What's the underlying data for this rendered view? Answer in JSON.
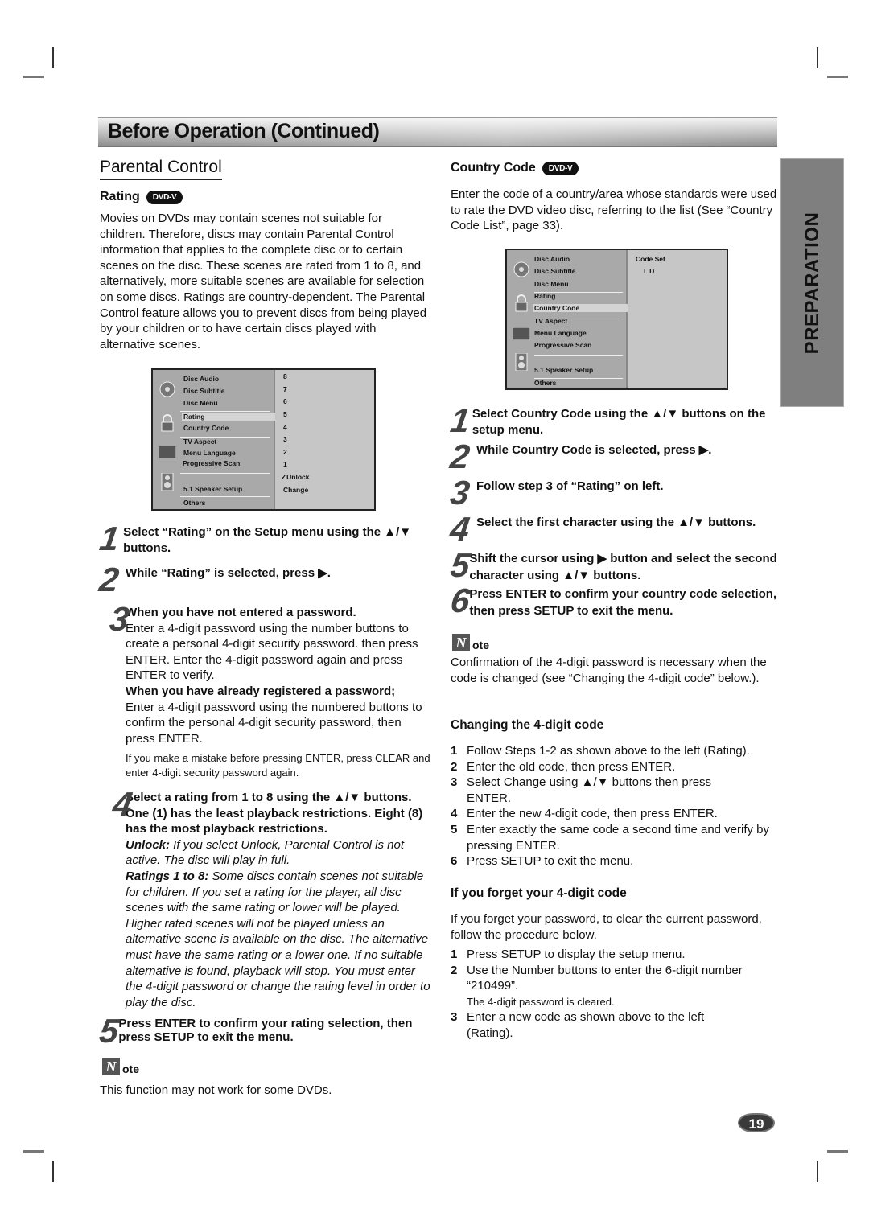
{
  "header": {
    "title": "Before Operation (Continued)"
  },
  "side_tab": {
    "label": "PREPARATION"
  },
  "page_number": "19",
  "parental": {
    "title": "Parental Control",
    "rating": {
      "heading": "Rating",
      "badge": "DVD-V",
      "intro": "Movies on DVDs may contain scenes not suitable for children. Therefore, discs may contain Parental Control information that applies to the complete disc or to certain scenes on the disc. These scenes are rated from 1 to 8, and alternatively, more suitable scenes are available for selection on some discs. Ratings are country-dependent. The Parental Control feature allows you to prevent discs from being played by your children or to have certain discs played with alternative scenes.",
      "menu": {
        "items": [
          "Disc Audio",
          "Disc Subtitle",
          "Disc Menu",
          "Rating",
          "Country Code",
          "TV Aspect",
          "Menu Language",
          "Progressive Scan",
          "5.1 Speaker Setup",
          "Others"
        ],
        "selected": "Rating",
        "values": [
          "8",
          "7",
          "6",
          "5",
          "4",
          "3",
          "2",
          "1",
          "✓Unlock",
          "Change"
        ]
      },
      "steps": [
        {
          "num": "1",
          "text": "Select “Rating” on the Setup menu using the ▲/▼ buttons."
        },
        {
          "num": "2",
          "text": "While “Rating” is selected, press ▶."
        },
        {
          "num": "3",
          "head1": "When you have not entered a password.",
          "body1": "Enter a 4-digit password using the number buttons to create a personal 4-digit security password. then press ENTER. Enter the 4-digit password again and press ENTER to verify.",
          "head2": "When you have already registered a password;",
          "body2": "Enter a 4-digit password using the numbered buttons to confirm the personal 4-digit security password, then press ENTER.",
          "tip": "If you make a mistake before pressing ENTER, press CLEAR and enter 4-digit security password again."
        },
        {
          "num": "4",
          "text": "Select a rating from 1 to 8 using the ▲/▼ buttons. One (1) has the least playback restrictions. Eight (8) has the most playback restrictions.",
          "unlock_label": "Unlock:",
          "unlock_text": " If you select Unlock, Parental Control is not active. The disc will play in full.",
          "ratings_label": "Ratings 1 to 8:",
          "ratings_text": " Some discs contain scenes not suitable for children. If you set a rating for the player, all disc scenes with the same rating or lower will be played. Higher rated scenes will not be played unless an alternative scene is available on the disc. The alternative must have the same rating or a lower one. If no suitable alternative is found, playback will stop. You must enter the 4-digit password or change the rating level in order to play the disc."
        },
        {
          "num": "5",
          "text": "Press ENTER to confirm your rating selection, then press SETUP to exit the menu."
        }
      ],
      "note": {
        "icon": "N",
        "label": "ote",
        "text": "This function may not work for some DVDs."
      }
    }
  },
  "country_code": {
    "heading": "Country Code",
    "badge": "DVD-V",
    "intro": "Enter the code of a country/area whose standards were used to rate the DVD video disc, referring to the list (See “Country Code List”, page 33).",
    "menu": {
      "items": [
        "Disc Audio",
        "Disc Subtitle",
        "Disc Menu",
        "Rating",
        "Country Code",
        "TV Aspect",
        "Menu Language",
        "Progressive Scan",
        "5.1 Speaker Setup",
        "Others"
      ],
      "selected": "Country Code",
      "code_set_label": "Code Set",
      "code_value": "I  D"
    },
    "steps": [
      {
        "num": "1",
        "text": "Select Country Code using the ▲/▼ buttons on the setup menu."
      },
      {
        "num": "2",
        "text": "While Country Code is selected, press ▶."
      },
      {
        "num": "3",
        "text": "Follow step 3 of “Rating” on left."
      },
      {
        "num": "4",
        "text": "Select the first character using the ▲/▼ buttons."
      },
      {
        "num": "5",
        "text": "Shift the cursor using ▶ button and select the second character using ▲/▼ buttons."
      },
      {
        "num": "6",
        "text": "Press ENTER to confirm your country code selection, then press SETUP to exit the menu."
      }
    ],
    "note": {
      "icon": "N",
      "label": "ote",
      "text": "Confirmation of the 4-digit password is necessary when the code is changed (see “Changing the 4-digit code” below.)."
    }
  },
  "changing": {
    "heading": "Changing the 4-digit code",
    "items": [
      {
        "n": "1",
        "text": "Follow Steps 1-2 as shown above to the left (Rating)."
      },
      {
        "n": "2",
        "text": "Enter the old code, then press ENTER."
      },
      {
        "n": "3",
        "text": "Select Change using ▲/▼ buttons then press ENTER."
      },
      {
        "n": "4",
        "text": "Enter the new 4-digit code, then press ENTER."
      },
      {
        "n": "5",
        "text": "Enter exactly the same code a second time and verify by pressing ENTER."
      },
      {
        "n": "6",
        "text": "Press SETUP to exit the menu."
      }
    ]
  },
  "forget": {
    "heading": "If you forget your 4-digit code",
    "intro": "If you forget your password, to clear the current password, follow the procedure below.",
    "items": [
      {
        "n": "1",
        "text": "Press SETUP to display the setup menu."
      },
      {
        "n": "2",
        "text": "Use the Number buttons to enter the 6-digit number “210499”.",
        "sub": "The 4-digit password is cleared."
      },
      {
        "n": "3",
        "text": "Enter a new code as shown above to the left (Rating)."
      }
    ]
  }
}
